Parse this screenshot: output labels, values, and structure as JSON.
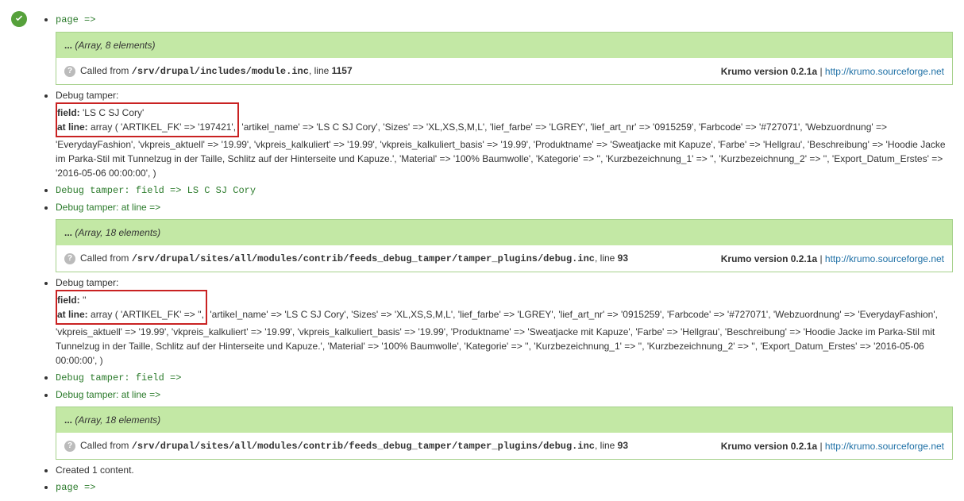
{
  "items": {
    "page_arrow": "page =>",
    "debug_tamper_label": "Debug tamper:",
    "field_label": "field:",
    "at_line_label": "at line:",
    "field_value_1": "'LS C SJ Cory'",
    "at_line_start_1": "array ( 'ARTIKEL_FK' => '197421',",
    "at_line_rest_1": " 'artikel_name' => 'LS C SJ Cory', 'Sizes' => 'XL,XS,S,M,L', 'lief_farbe' => 'LGREY', 'lief_art_nr' => '0915259', 'Farbcode' => '#727071', 'Webzuordnung' => 'EverydayFashion', 'vkpreis_aktuell' => '19.99', 'vkpreis_kalkuliert' => '19.99', 'vkpreis_kalkuliert_basis' => '19.99', 'Produktname' => 'Sweatjacke mit Kapuze', 'Farbe' => 'Hellgrau', 'Beschreibung' => 'Hoodie Jacke im Parka-Stil mit Tunnelzug in der Taille, Schlitz auf der Hinterseite und Kapuze.', 'Material' => '100% Baumwolle', 'Kategorie' => '', 'Kurzbezeichnung_1' => '', 'Kurzbezeichnung_2' => '', 'Export_Datum_Erstes' => '2016-05-06 00:00:00', )",
    "field_value_2": "''",
    "at_line_start_2": "array ( 'ARTIKEL_FK' => '',",
    "at_line_rest_2": " 'artikel_name' => 'LS C SJ Cory', 'Sizes' => 'XL,XS,S,M,L', 'lief_farbe' => 'LGREY', 'lief_art_nr' => '0915259', 'Farbcode' => '#727071', 'Webzuordnung' => 'EverydayFashion', 'vkpreis_aktuell' => '19.99', 'vkpreis_kalkuliert' => '19.99', 'vkpreis_kalkuliert_basis' => '19.99', 'Produktname' => 'Sweatjacke mit Kapuze', 'Farbe' => 'Hellgrau', 'Beschreibung' => 'Hoodie Jacke im Parka-Stil mit Tunnelzug in der Taille, Schlitz auf der Hinterseite und Kapuze.', 'Material' => '100% Baumwolle', 'Kategorie' => '', 'Kurzbezeichnung_1' => '', 'Kurzbezeichnung_2' => '', 'Export_Datum_Erstes' => '2016-05-06 00:00:00', )",
    "debug_field_1": "Debug tamper: field => LS C SJ Cory",
    "debug_field_2": "Debug tamper: field =>",
    "debug_atline": "Debug tamper: at line =>",
    "created": "Created 1 content."
  },
  "krumo": {
    "ellipsis": "...",
    "array8": "(Array, 8 elements)",
    "array18": "(Array, 18 elements)",
    "called_from": "Called from ",
    "path1": "/srv/drupal/includes/module.inc",
    "line1_pre": ", line ",
    "line1": "1157",
    "path2": "/srv/drupal/sites/all/modules/contrib/feeds_debug_tamper/tamper_plugins/debug.inc",
    "line2": "93",
    "version_label": "Krumo version 0.2.1a",
    "pipe": " | ",
    "link": "http://krumo.sourceforge.net"
  }
}
